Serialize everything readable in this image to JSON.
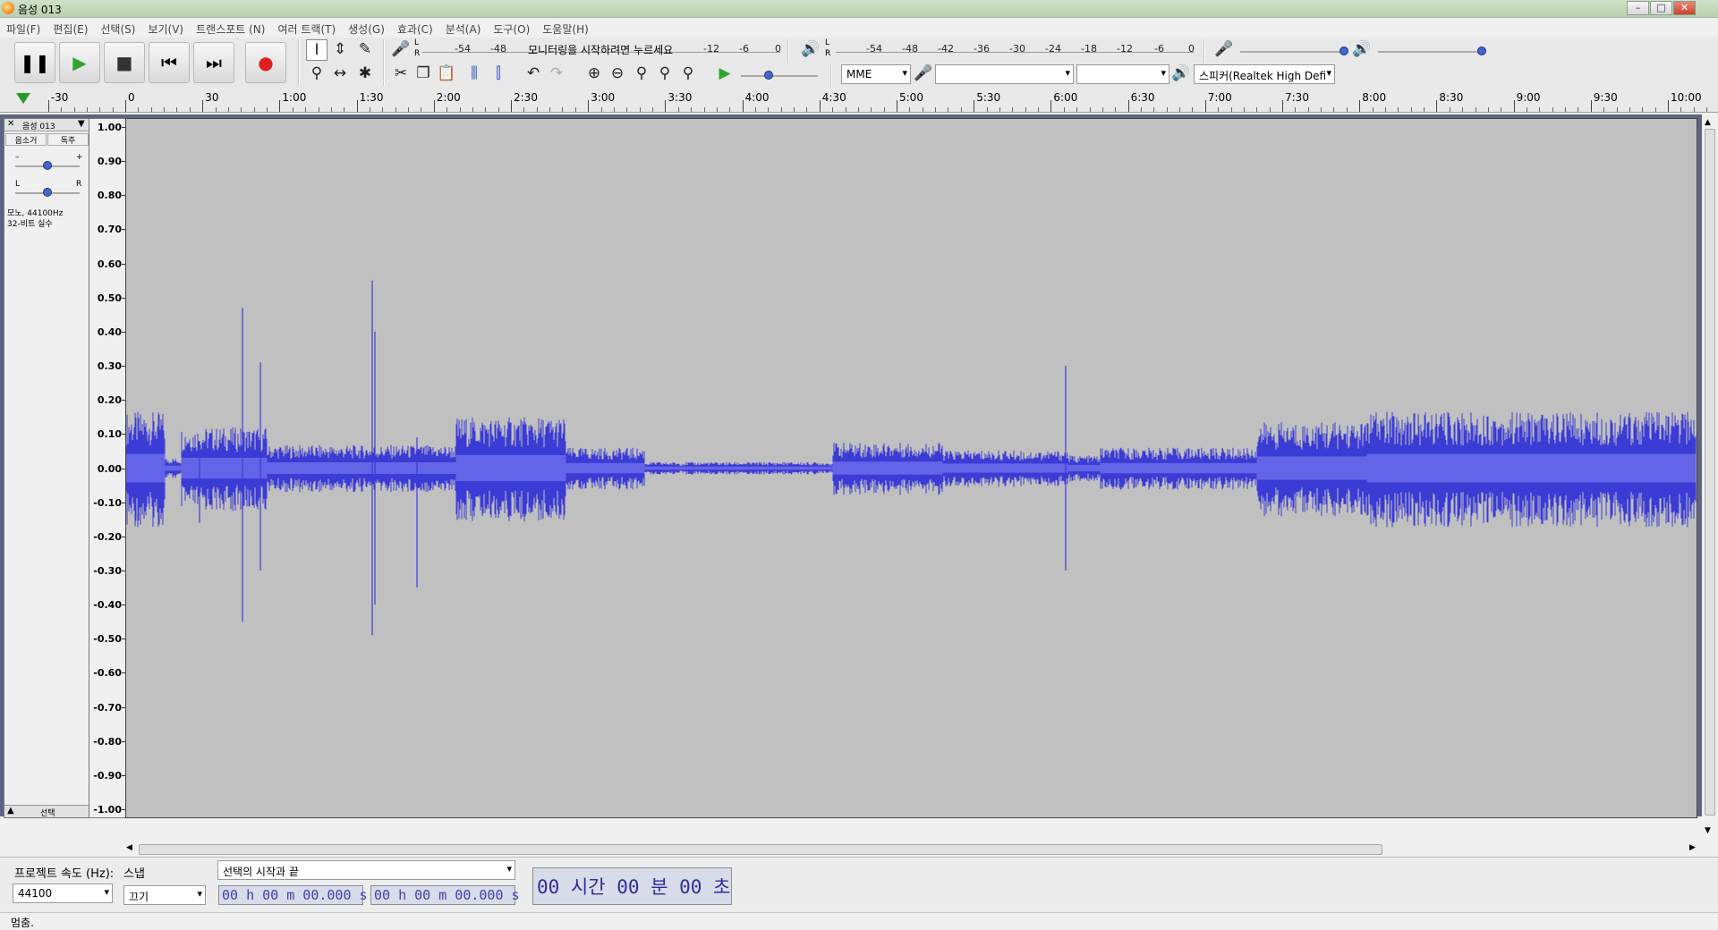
{
  "window": {
    "title": "음성 013",
    "controls": [
      "–",
      "□",
      "✕"
    ]
  },
  "menu": [
    "파일(F)",
    "편집(E)",
    "선택(S)",
    "보기(V)",
    "트랜스포트 (N)",
    "여러 트랙(T)",
    "생성(G)",
    "효과(C)",
    "분석(A)",
    "도구(O)",
    "도움말(H)"
  ],
  "transport": {
    "pause": "❚❚",
    "play": "▶",
    "stop": "■",
    "skip_start": "⏮",
    "skip_end": "⏭",
    "record": "●"
  },
  "meters": {
    "record_scale": [
      "-54",
      "-48",
      "-12",
      "-6",
      "0"
    ],
    "record_hint": "모니터링을 시작하려면 누르세요",
    "play_scale": [
      "-54",
      "-48",
      "-42",
      "-36",
      "-30",
      "-24",
      "-18",
      "-12",
      "-6",
      "0"
    ],
    "lr": [
      "L",
      "R"
    ]
  },
  "device": {
    "host": "MME",
    "record_device": "",
    "channels": "",
    "playback_device": "스피커(Realtek High Defi"
  },
  "ruler": {
    "labels": [
      "-30",
      "0",
      "30",
      "1:00",
      "1:30",
      "2:00",
      "2:30",
      "3:00",
      "3:30",
      "4:00",
      "4:30",
      "5:00",
      "5:30",
      "6:00",
      "6:30",
      "7:00",
      "7:30",
      "8:00",
      "8:30",
      "9:00",
      "9:30",
      "10:00"
    ]
  },
  "track": {
    "name": "음성 013",
    "close": "✕",
    "mute": "음소거",
    "solo": "독주",
    "gain_minus": "–",
    "gain_plus": "+",
    "pan_left": "L",
    "pan_right": "R",
    "info_line1": "모노, 44100Hz",
    "info_line2": "32-비트 실수",
    "collapse": "▲",
    "select": "선택"
  },
  "amplitude_labels": [
    "1.00",
    "0.90",
    "0.80",
    "0.70",
    "0.60",
    "0.50",
    "0.40",
    "0.30",
    "0.20",
    "0.10",
    "0.00",
    "-0.10",
    "-0.20",
    "-0.30",
    "-0.40",
    "-0.50",
    "-0.60",
    "-0.70",
    "-0.80",
    "-0.90",
    "-1.00"
  ],
  "selection_toolbar": {
    "rate_label": "프로젝트 속도 (Hz):",
    "rate_value": "44100",
    "snap_label": "스냅",
    "snap_value": "끄기",
    "mode_value": "선택의 시작과 끝",
    "start_time": "00 h 00 m 00.000 s",
    "end_time": "00 h 00 m 00.000 s",
    "big_time": "00 시간 00 분 00 초"
  },
  "status": "멈춤.",
  "colors": {
    "waveform": "#3b3bd6",
    "waveform_rms": "#6464e8",
    "track_bg": "#c0c0c0",
    "workspace": "#5e6584",
    "record": "#e02020",
    "play": "#2fa52f"
  }
}
